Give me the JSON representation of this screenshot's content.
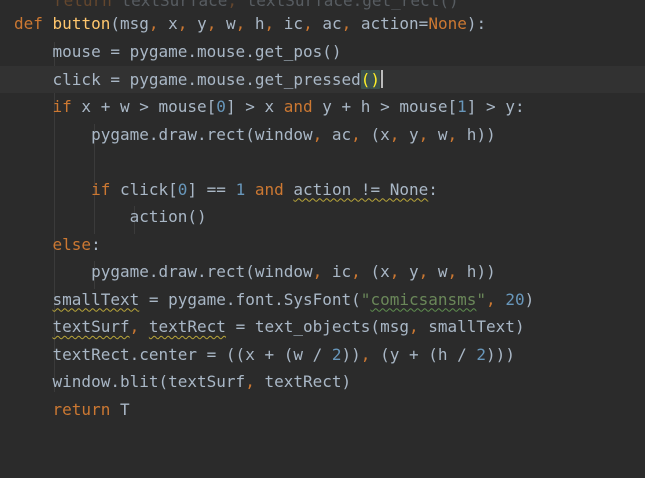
{
  "theme": {
    "background": "#2b2b2b",
    "keyword": "#cc7832",
    "function_name": "#ffc66d",
    "string": "#6a8759",
    "number": "#6897bb",
    "text": "#a9b7c6"
  },
  "code": {
    "line_0": {
      "t1": "return",
      "t2": " textSurface",
      "t3": ",",
      "t4": " textSurface.get_rect()"
    },
    "line_1": {
      "t1": "def",
      "t2": " ",
      "t3": "button",
      "t4": "(",
      "t5": "msg",
      "t6": ",",
      "t7": " x",
      "t8": ",",
      "t9": " y",
      "t10": ",",
      "t11": " w",
      "t12": ",",
      "t13": " h",
      "t14": ",",
      "t15": " ic",
      "t16": ",",
      "t17": " ac",
      "t18": ",",
      "t19": " action=",
      "t20": "None",
      "t21": "):"
    },
    "line_2": {
      "t1": "    mouse = pygame.mouse.get_pos()"
    },
    "line_3": {
      "t1": "    click = pygame.mouse.get_pressed",
      "t2": "(",
      "t3": ")"
    },
    "line_4": {
      "t1": "    ",
      "t2": "if",
      "t3": " x + w > mouse[",
      "t4": "0",
      "t5": "] > x ",
      "t6": "and",
      "t7": " y + h > mouse[",
      "t8": "1",
      "t9": "] > y:"
    },
    "line_5": {
      "t1": "        pygame.draw.rect(window",
      "t2": ",",
      "t3": " ac",
      "t4": ",",
      "t5": " (x",
      "t6": ",",
      "t7": " y",
      "t8": ",",
      "t9": " w",
      "t10": ",",
      "t11": " h))"
    },
    "line_6": {
      "t1": ""
    },
    "line_7": {
      "t1": "        ",
      "t2": "if",
      "t3": " click[",
      "t4": "0",
      "t5": "] == ",
      "t6": "1",
      "t7": " ",
      "t8": "and",
      "t9": " ",
      "t10": "action != None",
      "t11": ":"
    },
    "line_8": {
      "t1": "            action()"
    },
    "line_9": {
      "t1": "    ",
      "t2": "else",
      "t3": ":"
    },
    "line_10": {
      "t1": "        pygame.draw.rect(window",
      "t2": ",",
      "t3": " ic",
      "t4": ",",
      "t5": " (x",
      "t6": ",",
      "t7": " y",
      "t8": ",",
      "t9": " w",
      "t10": ",",
      "t11": " h))"
    },
    "line_11": {
      "t1": "    ",
      "t2": "smallText",
      "t3": " = pygame.font.SysFont(",
      "t4": "\"",
      "t5": "comicsansms",
      "t6": "\"",
      "t7": ",",
      "t8": " ",
      "t9": "20",
      "t10": ")"
    },
    "line_12": {
      "t1": "    ",
      "t2": "textSurf",
      "t3": ",",
      "t4": " ",
      "t5": "textRect",
      "t6": " = text_objects(msg",
      "t7": ",",
      "t8": " smallText)"
    },
    "line_13": {
      "t1": "    textRect.center = ((x + (w / ",
      "t2": "2",
      "t3": "))",
      "t4": ",",
      "t5": " (y + (h / ",
      "t6": "2",
      "t7": ")))"
    },
    "line_14": {
      "t1": "    window.blit(textSurf",
      "t2": ",",
      "t3": " textRect)"
    },
    "line_15": {
      "t1": "    ",
      "t2": "return",
      "t3": " ",
      "t4": "T"
    }
  }
}
